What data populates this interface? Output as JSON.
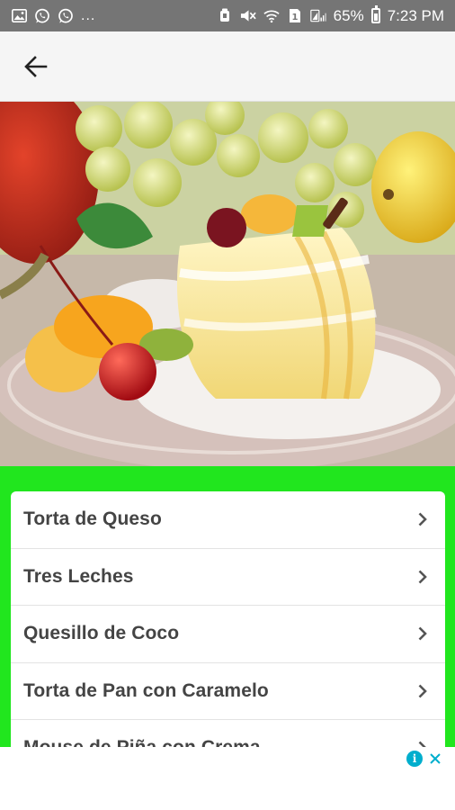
{
  "status_bar": {
    "left_icons": [
      "gallery-icon",
      "whatsapp-icon",
      "whatsapp-icon"
    ],
    "overflow": "...",
    "battery_percent": "65%",
    "time": "7:23 PM"
  },
  "app_bar": {
    "back_icon": "arrow-back-icon"
  },
  "hero": {
    "description_icon": "fruit-cake-photo"
  },
  "colors": {
    "accent_green": "#21e61e",
    "status_bar": "#757575",
    "ad_info": "#00aecd"
  },
  "recipes": [
    {
      "label": "Torta de Queso"
    },
    {
      "label": "Tres Leches"
    },
    {
      "label": "Quesillo de Coco"
    },
    {
      "label": "Torta de Pan con Caramelo"
    },
    {
      "label": "Mouse de Piña con Crema"
    }
  ]
}
